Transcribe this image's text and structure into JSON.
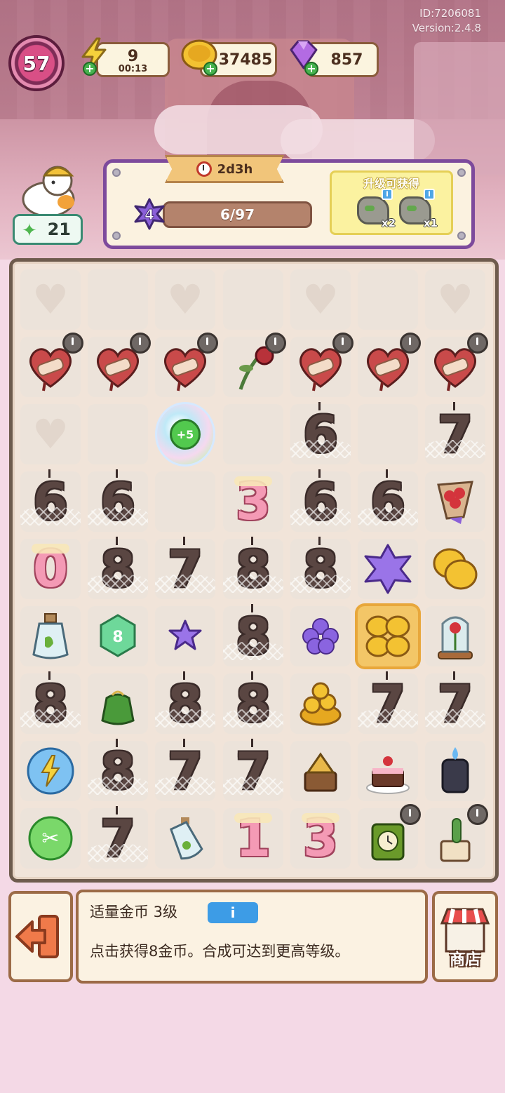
{
  "meta": {
    "id_line": "ID:7206081",
    "version_line": "Version:2.4.8"
  },
  "hud": {
    "level": "57",
    "energy": {
      "value": "9",
      "timer": "00:13"
    },
    "coins": "37485",
    "gems": "857"
  },
  "player": {
    "stars": "21"
  },
  "quest": {
    "time_left": "2d3h",
    "star_level": "4",
    "progress_text": "6/97",
    "progress_fraction": 0.062,
    "reward_title": "升级可获得",
    "rewards": [
      {
        "icon": "rock-chest-icon",
        "count": "x2"
      },
      {
        "icon": "rock-chest-icon",
        "count": "x1"
      }
    ]
  },
  "board": {
    "bubble_label": "+5",
    "grid": [
      [
        "heart",
        "empty",
        "heart",
        "empty",
        "heart",
        "empty",
        "heart"
      ],
      [
        "bandaged-heart",
        "bandaged-heart",
        "bandaged-heart",
        "wilted-rose",
        "bandaged-heart",
        "bandaged-heart",
        "bandaged-heart"
      ],
      [
        "heart",
        "empty",
        "bubble",
        "empty",
        "rot:6",
        "empty",
        "rot:7"
      ],
      [
        "rot:6",
        "rot:6",
        "empty",
        "pink:3",
        "rot:6",
        "rot:6",
        "bouquet"
      ],
      [
        "pink:0",
        "rot:8",
        "rot:7",
        "rot:8",
        "rot:8",
        "purple-star-big",
        "coins-2"
      ],
      [
        "potion",
        "green-crystal",
        "purple-star-small",
        "rot:8",
        "purple-flower",
        "coins-pile-sel",
        "glass-rose"
      ],
      [
        "rot:8",
        "green-bag",
        "rot:8",
        "rot:8",
        "coins-heap",
        "rot:7",
        "rot:7"
      ],
      [
        "energy-orb",
        "rot:8",
        "rot:7",
        "rot:7",
        "music-box",
        "cake",
        "lantern"
      ],
      [
        "scissors-orb",
        "rot:7",
        "small-potion",
        "pink:1",
        "pink:3",
        "green-clock",
        "cactus-pot"
      ]
    ]
  },
  "selected_item": {
    "title": "适量金币 3级",
    "info_button": "i",
    "description": "点击获得8金币。合成可达到更高等级。"
  },
  "buttons": {
    "shop": "商店"
  },
  "colors": {
    "panel_border": "#7d4a9c",
    "board_border": "#6e5b4d",
    "accent_green": "#46b24e"
  }
}
